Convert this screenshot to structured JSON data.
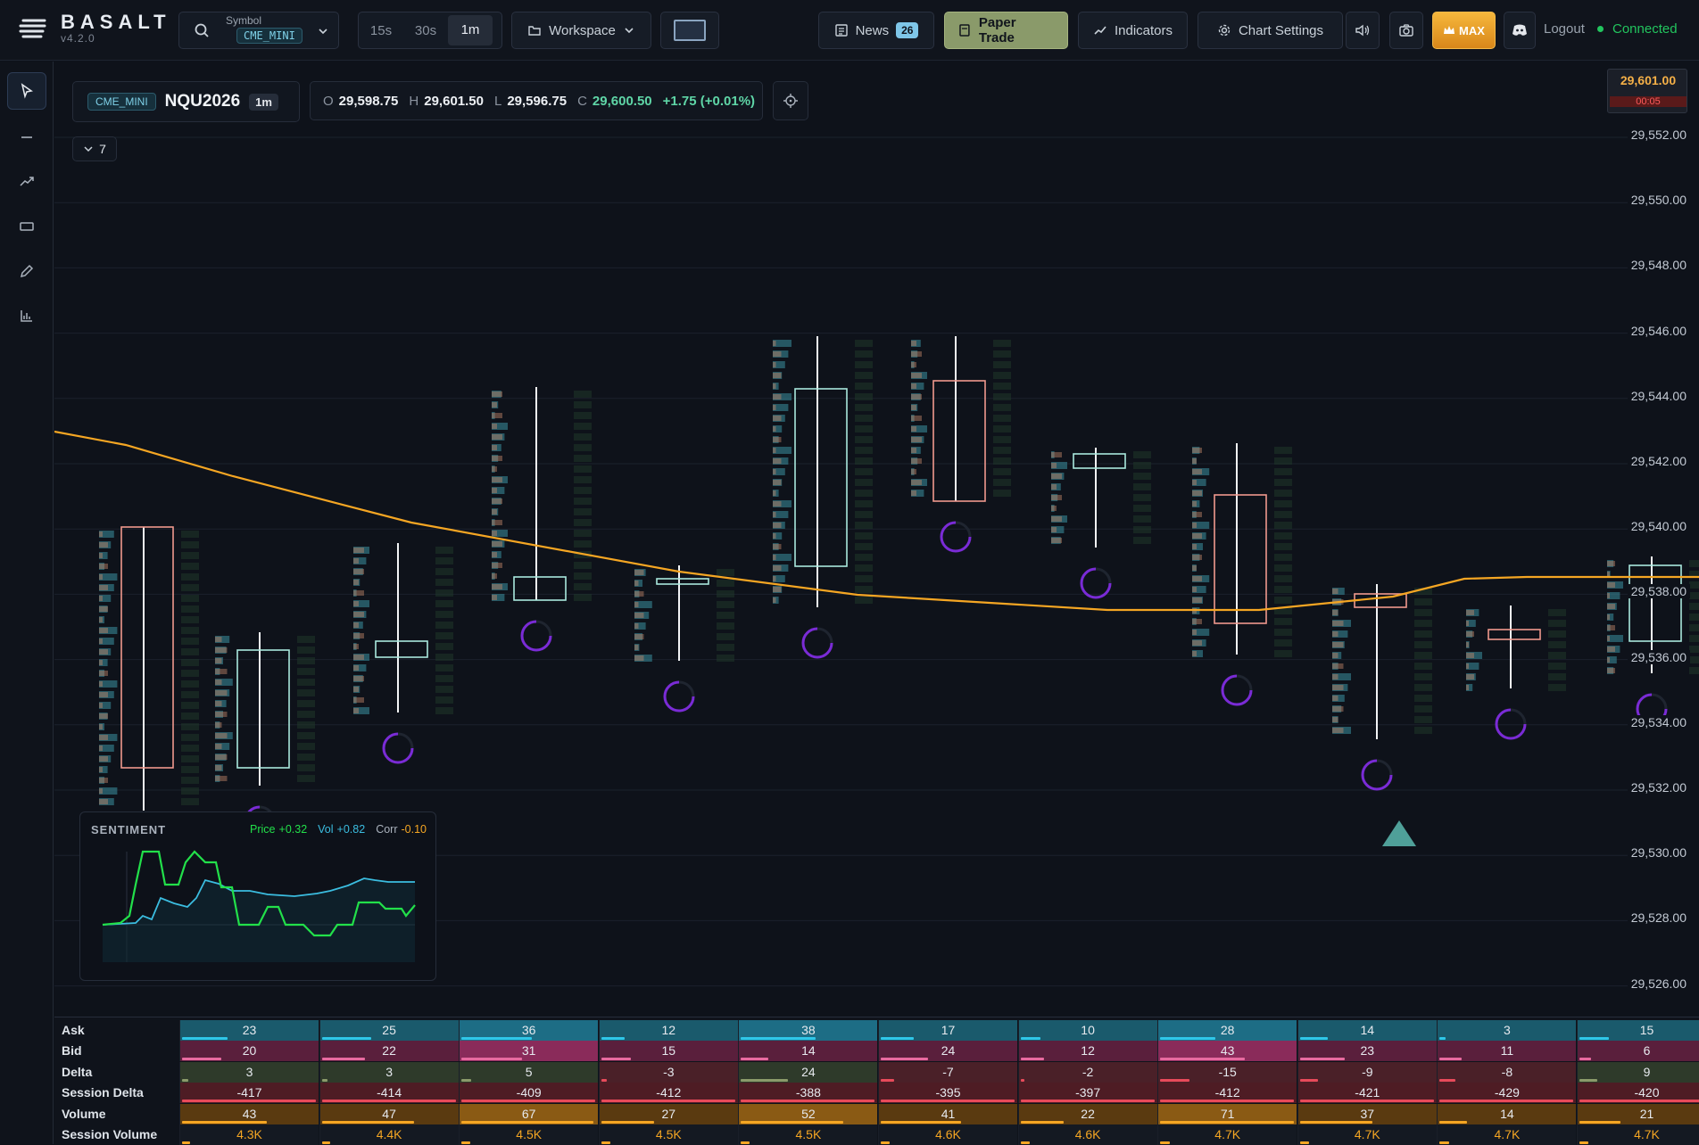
{
  "app": {
    "name": "BASALT",
    "version": "v4.2.0"
  },
  "toolbar": {
    "symbol_label": "Symbol",
    "symbol_value": "CME_MINI",
    "timeframes": [
      "15s",
      "30s",
      "1m"
    ],
    "active_timeframe": "1m",
    "workspace_label": "Workspace",
    "news_label": "News",
    "news_count": "26",
    "paper_trade_label": "Paper Trade",
    "indicators_label": "Indicators",
    "chart_settings_label": "Chart Settings",
    "max_label": "MAX",
    "logout_label": "Logout",
    "status_label": "Connected"
  },
  "chart_header": {
    "exchange": "CME_MINI",
    "symbol": "NQU2026",
    "interval": "1m",
    "o_label": "O",
    "o_value": "29,598.75",
    "h_label": "H",
    "h_value": "29,601.50",
    "l_label": "L",
    "l_value": "29,596.75",
    "c_label": "C",
    "c_value": "29,600.50",
    "change": "+1.75 (+0.01%)",
    "collapse_count": "7"
  },
  "price_axis": {
    "current_price": "29,601.00",
    "countdown": "00:05",
    "labels": [
      "29,552.00",
      "29,550.00",
      "29,548.00",
      "29,546.00",
      "29,544.00",
      "29,542.00",
      "29,540.00",
      "29,538.00",
      "29,536.00",
      "29,534.00",
      "29,532.00",
      "29,530.00",
      "29,528.00",
      "29,526.00"
    ]
  },
  "sentiment": {
    "title": "SENTIMENT",
    "price_label": "Price",
    "price_value": "+0.32",
    "vol_label": "Vol",
    "vol_value": "+0.82",
    "corr_label": "Corr",
    "corr_value": "-0.10"
  },
  "stats_table": {
    "rows": [
      {
        "label": "Ask",
        "values": [
          "23",
          "25",
          "36",
          "12",
          "38",
          "17",
          "10",
          "28",
          "14",
          "3",
          "15"
        ]
      },
      {
        "label": "Bid",
        "values": [
          "20",
          "22",
          "31",
          "15",
          "14",
          "24",
          "12",
          "43",
          "23",
          "11",
          "6"
        ]
      },
      {
        "label": "Delta",
        "values": [
          "3",
          "3",
          "5",
          "-3",
          "24",
          "-7",
          "-2",
          "-15",
          "-9",
          "-8",
          "9"
        ]
      },
      {
        "label": "Session Delta",
        "values": [
          "-417",
          "-414",
          "-409",
          "-412",
          "-388",
          "-395",
          "-397",
          "-412",
          "-421",
          "-429",
          "-420"
        ]
      },
      {
        "label": "Volume",
        "values": [
          "43",
          "47",
          "67",
          "27",
          "52",
          "41",
          "22",
          "71",
          "37",
          "14",
          "21"
        ]
      },
      {
        "label": "Session Volume",
        "values": [
          "4.3K",
          "4.4K",
          "4.5K",
          "4.5K",
          "4.5K",
          "4.6K",
          "4.6K",
          "4.7K",
          "4.7K",
          "4.7K",
          "4.7K"
        ]
      }
    ]
  },
  "colors": {
    "accent": "#f5a623",
    "bull": "#4fc3b8",
    "bear": "#e8837a",
    "connected": "#22c55e"
  }
}
